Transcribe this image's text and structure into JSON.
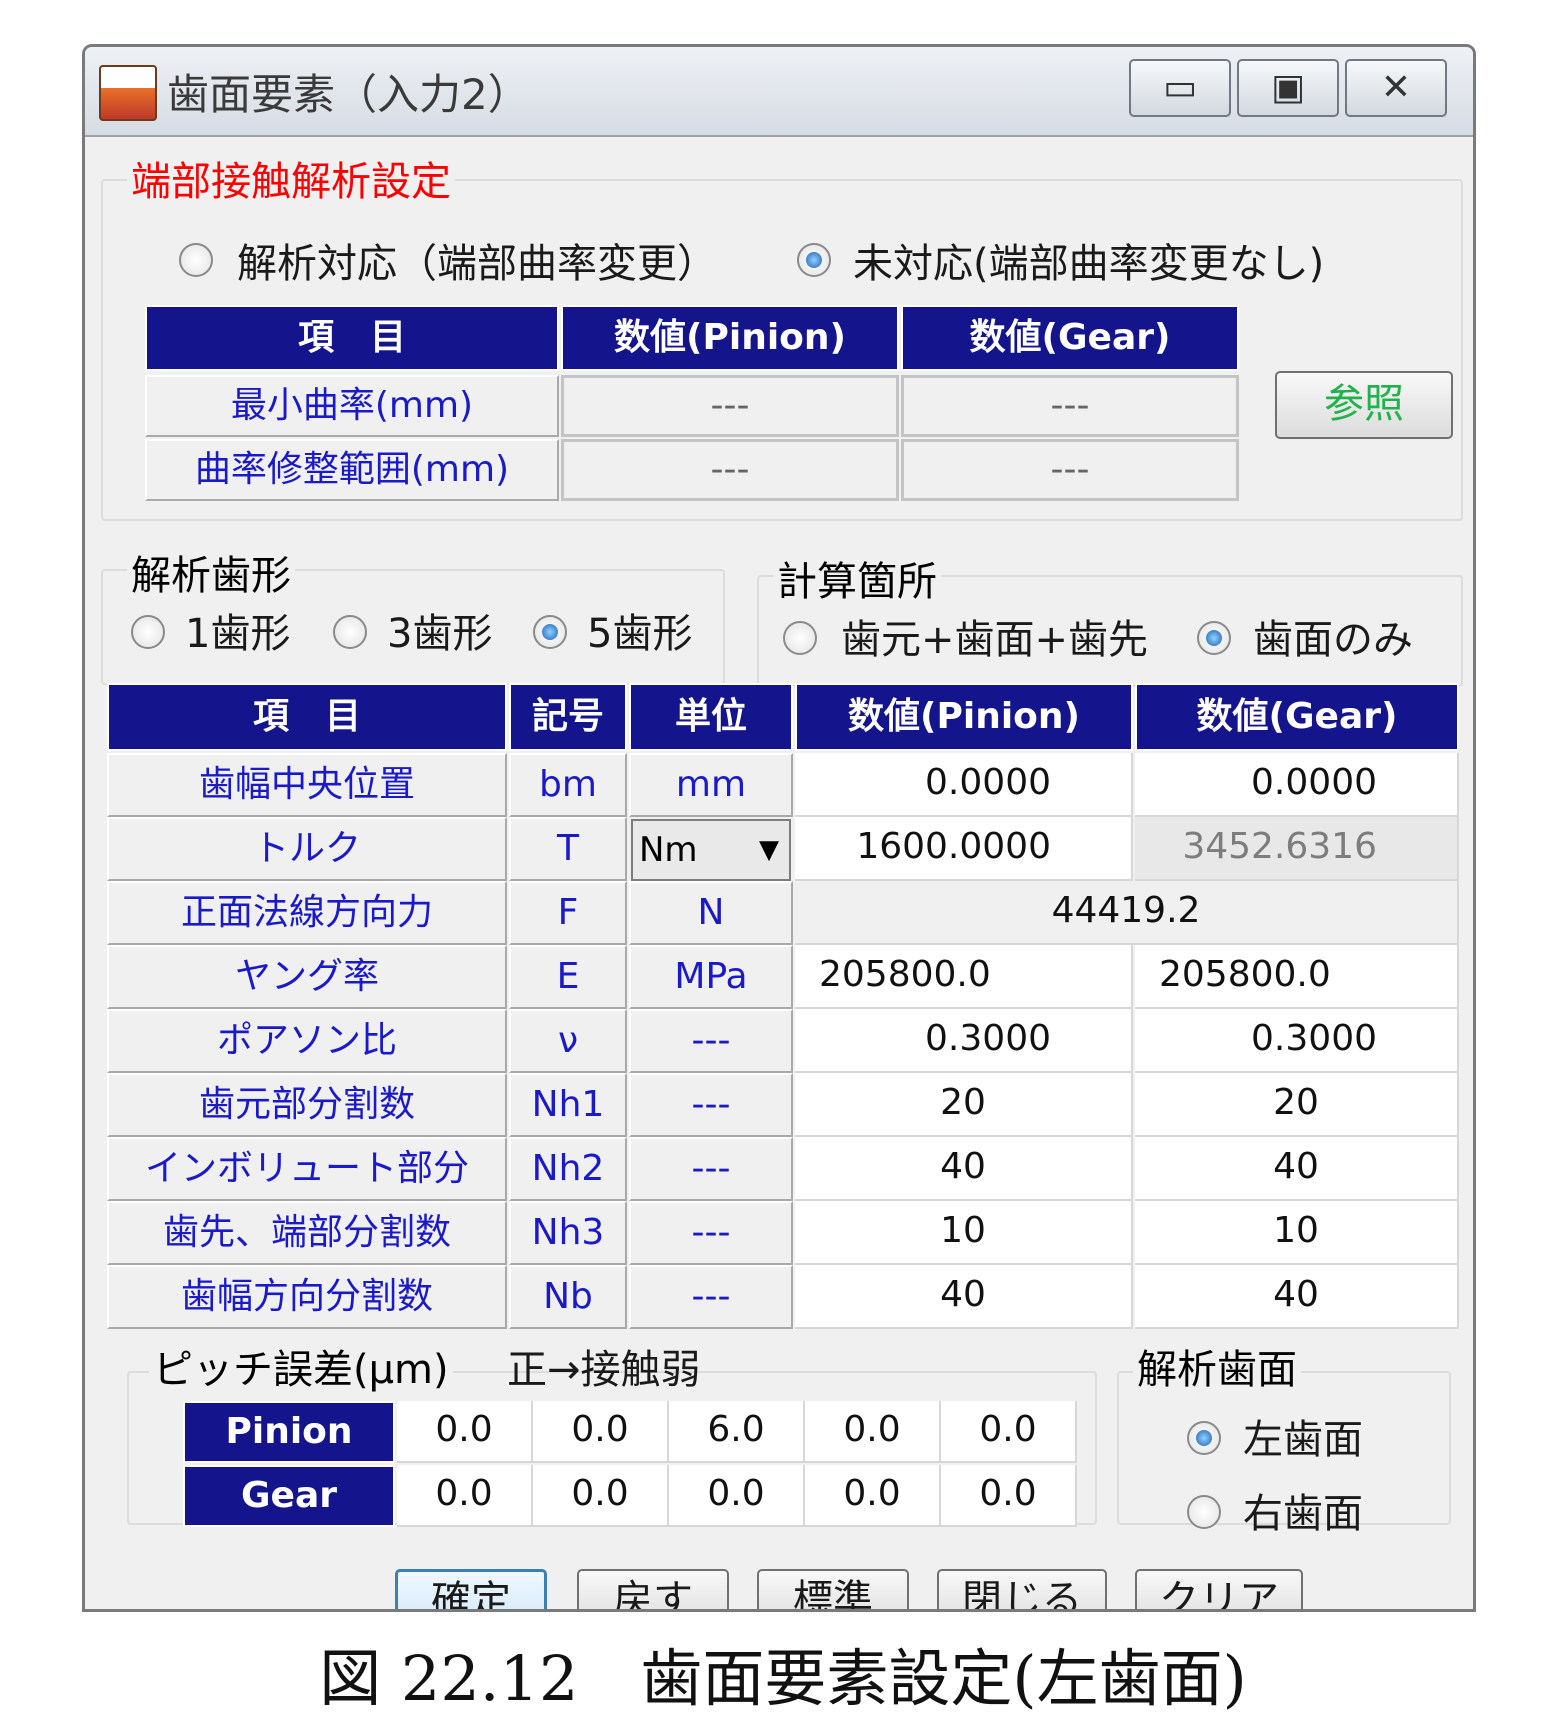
{
  "window": {
    "title": "歯面要素（入力2）",
    "controls": {
      "minimize": "▭",
      "maximize": "▣",
      "close": "✕"
    }
  },
  "edge_contact": {
    "group_title": "端部接触解析設定",
    "options": [
      {
        "label": "解析対応（端部曲率変更）",
        "selected": false
      },
      {
        "label": "未対応(端部曲率変更なし)",
        "selected": true
      }
    ],
    "headers": [
      "項　目",
      "数値(Pinion)",
      "数値(Gear)"
    ],
    "rows": [
      {
        "label": "最小曲率(mm)",
        "pinion": "---",
        "gear": "---"
      },
      {
        "label": "曲率修整範囲(mm)",
        "pinion": "---",
        "gear": "---"
      }
    ],
    "reference_button": "参照"
  },
  "tooth_profile": {
    "group_title": "解析歯形",
    "options": [
      {
        "label": "1歯形",
        "selected": false
      },
      {
        "label": "3歯形",
        "selected": false
      },
      {
        "label": "5歯形",
        "selected": true
      }
    ]
  },
  "calc_location": {
    "group_title": "計算箇所",
    "options": [
      {
        "label": "歯元+歯面+歯先",
        "selected": false
      },
      {
        "label": "歯面のみ",
        "selected": true
      }
    ]
  },
  "params": {
    "headers": [
      "項　目",
      "記号",
      "単位",
      "数値(Pinion)",
      "数値(Gear)"
    ],
    "rows": [
      {
        "item": "歯幅中央位置",
        "symbol": "bm",
        "unit": "mm",
        "pinion": "0.0000",
        "gear": "0.0000"
      },
      {
        "item": "トルク",
        "symbol": "T",
        "unit": "Nm",
        "pinion": "1600.0000",
        "gear": "3452.6316"
      },
      {
        "item": "正面法線方向力",
        "symbol": "F",
        "unit": "N",
        "merged": "44419.2"
      },
      {
        "item": "ヤング率",
        "symbol": "E",
        "unit": "MPa",
        "pinion": "205800.0",
        "gear": "205800.0"
      },
      {
        "item": "ポアソン比",
        "symbol": "ν",
        "unit": "---",
        "pinion": "0.3000",
        "gear": "0.3000"
      },
      {
        "item": "歯元部分割数",
        "symbol": "Nh1",
        "unit": "---",
        "pinion": "20",
        "gear": "20"
      },
      {
        "item": "インボリュート部分",
        "symbol": "Nh2",
        "unit": "---",
        "pinion": "40",
        "gear": "40"
      },
      {
        "item": "歯先、端部分割数",
        "symbol": "Nh3",
        "unit": "---",
        "pinion": "10",
        "gear": "10"
      },
      {
        "item": "歯幅方向分割数",
        "symbol": "Nb",
        "unit": "---",
        "pinion": "40",
        "gear": "40"
      }
    ]
  },
  "pitch_error": {
    "group_title": "ピッチ誤差(μm)",
    "note": "正→接触弱",
    "rows": [
      {
        "label": "Pinion",
        "values": [
          "0.0",
          "0.0",
          "6.0",
          "0.0",
          "0.0"
        ]
      },
      {
        "label": "Gear",
        "values": [
          "0.0",
          "0.0",
          "0.0",
          "0.0",
          "0.0"
        ]
      }
    ]
  },
  "flank": {
    "group_title": "解析歯面",
    "options": [
      {
        "label": "左歯面",
        "selected": true
      },
      {
        "label": "右歯面",
        "selected": false
      }
    ]
  },
  "buttons": [
    "確定",
    "戻す",
    "標準",
    "閉じる",
    "クリア"
  ],
  "caption": "図 22.12　歯面要素設定(左歯面)",
  "colors": {
    "header_bg": "#14148c",
    "label_text": "#1a1ac8",
    "group_title_red": "#ff0000",
    "reference_text": "#22b24c"
  }
}
